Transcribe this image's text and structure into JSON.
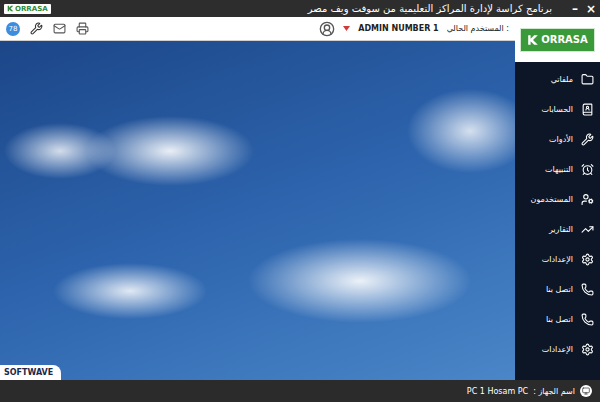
{
  "window": {
    "title": "برنامج كراسة لإدارة المراكز التعليمية من سوفت ويف مصر",
    "logo": "ORRASA",
    "controls": [
      "–",
      "×"
    ]
  },
  "toolbar": {
    "badge": "78",
    "user_label": "المستخدم الحالي :",
    "user_name": "ADMIN NUMBER 1"
  },
  "sidebar": {
    "logo": "ORRASA",
    "items": [
      {
        "label": "ملفاتي"
      },
      {
        "label": "الحسابات"
      },
      {
        "label": "الأدوات"
      },
      {
        "label": "التنبيهات"
      },
      {
        "label": "المستخدمون"
      },
      {
        "label": "التقارير"
      },
      {
        "label": "الإعدادات"
      },
      {
        "label": "اتصل بنا"
      },
      {
        "label": "اتصل بنا"
      },
      {
        "label": "الإعدادات"
      }
    ]
  },
  "watermark": "SOFTWAVE",
  "status_bar": {
    "label": "اسم الجهاز :",
    "value": "PC 1 Hosam PC"
  }
}
